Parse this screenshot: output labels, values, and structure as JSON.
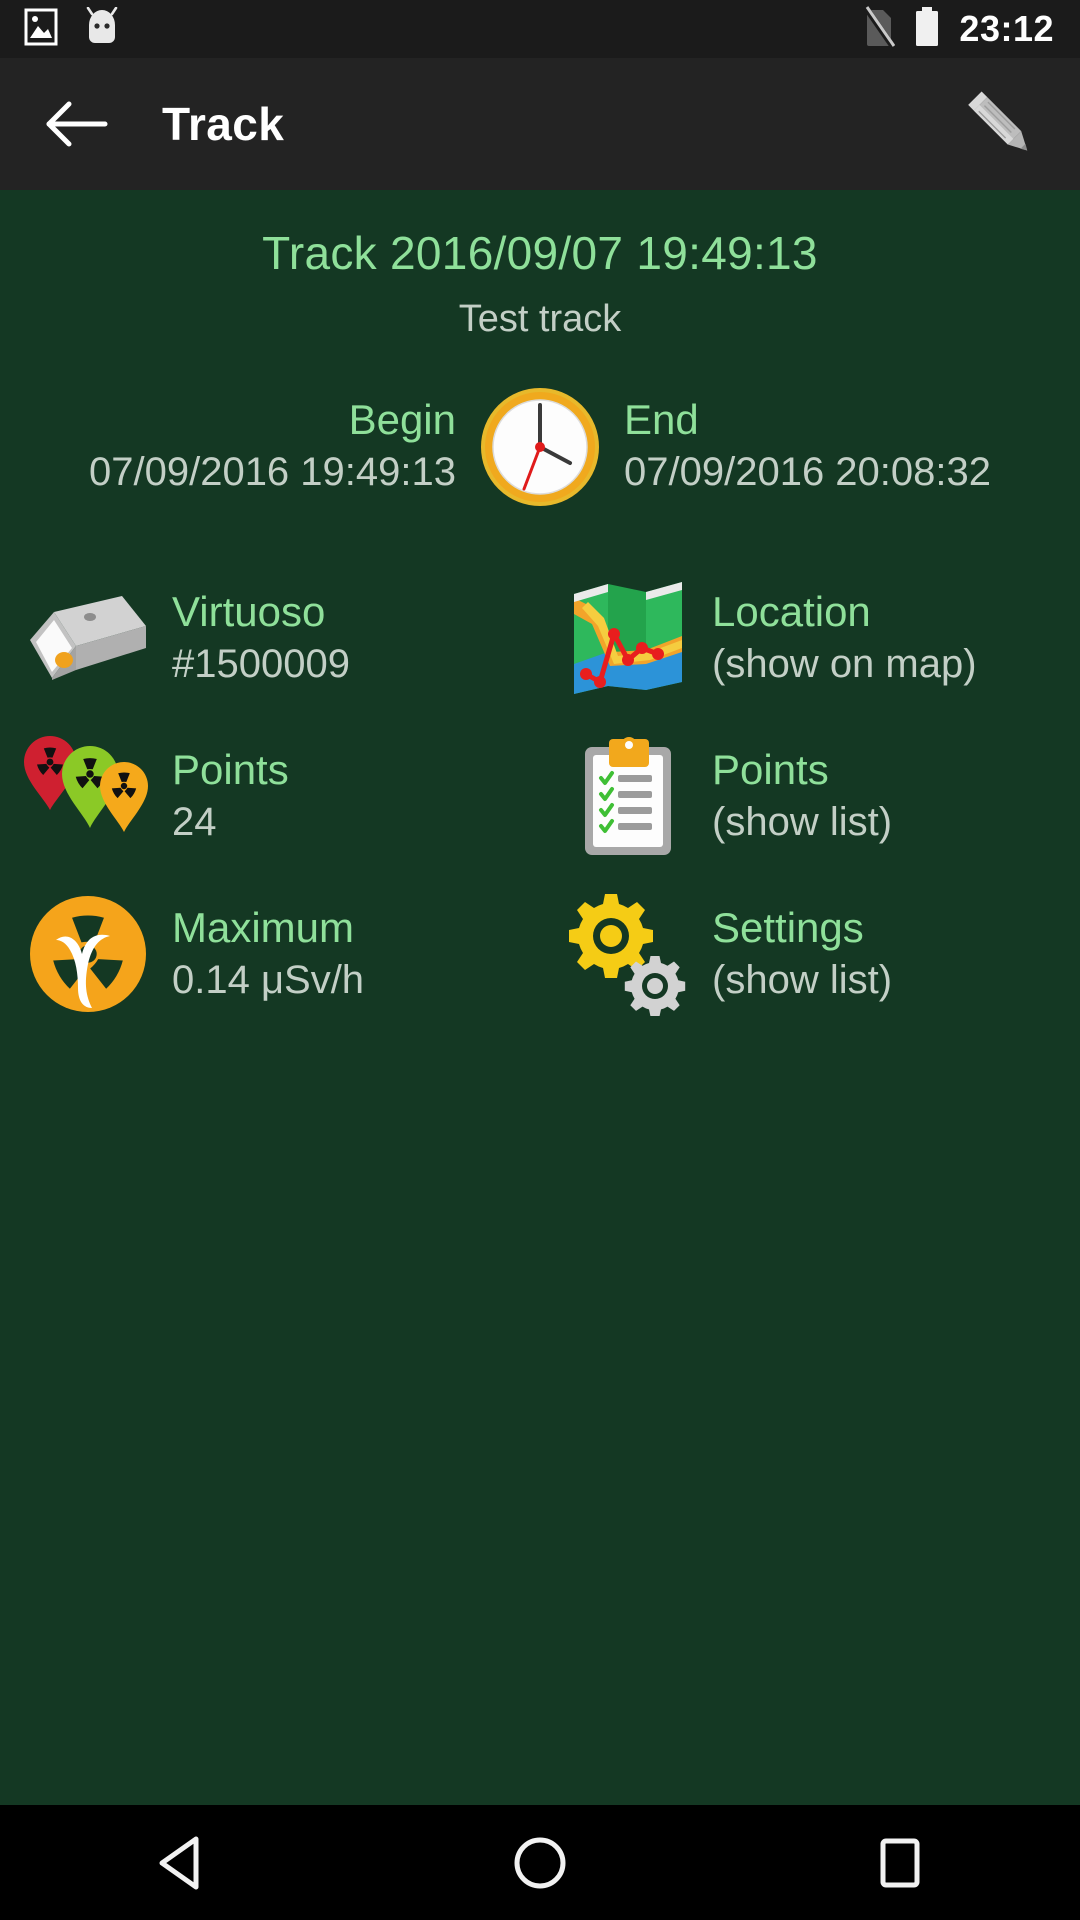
{
  "statusbar": {
    "time": "23:12",
    "icons": [
      {
        "name": "image-icon"
      },
      {
        "name": "android-head-icon"
      },
      {
        "name": "no-sim-icon"
      },
      {
        "name": "battery-full-icon"
      }
    ]
  },
  "appbar": {
    "back_label": "back-arrow",
    "title": "Track",
    "edit_label": "pencil-edit"
  },
  "track": {
    "title": "Track 2016/09/07 19:49:13",
    "subtitle": "Test track",
    "begin_label": "Begin",
    "begin_value": "07/09/2016 19:49:13",
    "end_label": "End",
    "end_value": "07/09/2016 20:08:32"
  },
  "info": [
    {
      "icon": "device-icon",
      "label": "Virtuoso",
      "value": "#1500009"
    },
    {
      "icon": "map-icon",
      "label": "Location",
      "value": "(show on map)"
    },
    {
      "icon": "radiation-pins-icon",
      "label": "Points",
      "value": "24"
    },
    {
      "icon": "clipboard-icon",
      "label": "Points",
      "value": "(show list)"
    },
    {
      "icon": "gamma-radiation-icon",
      "label": "Maximum",
      "value": "0.14 μSv/h"
    },
    {
      "icon": "gears-icon",
      "label": "Settings",
      "value": "(show list)"
    }
  ],
  "navbar": {
    "back": "back-triangle",
    "home": "home-circle",
    "recents": "recents-square"
  },
  "colors": {
    "background": "#143823",
    "statusbar": "#1b1b1b",
    "appbar": "#232323",
    "label_green": "#8fe09a",
    "value_gray": "#c3cfc6",
    "navbar": "#000000"
  }
}
